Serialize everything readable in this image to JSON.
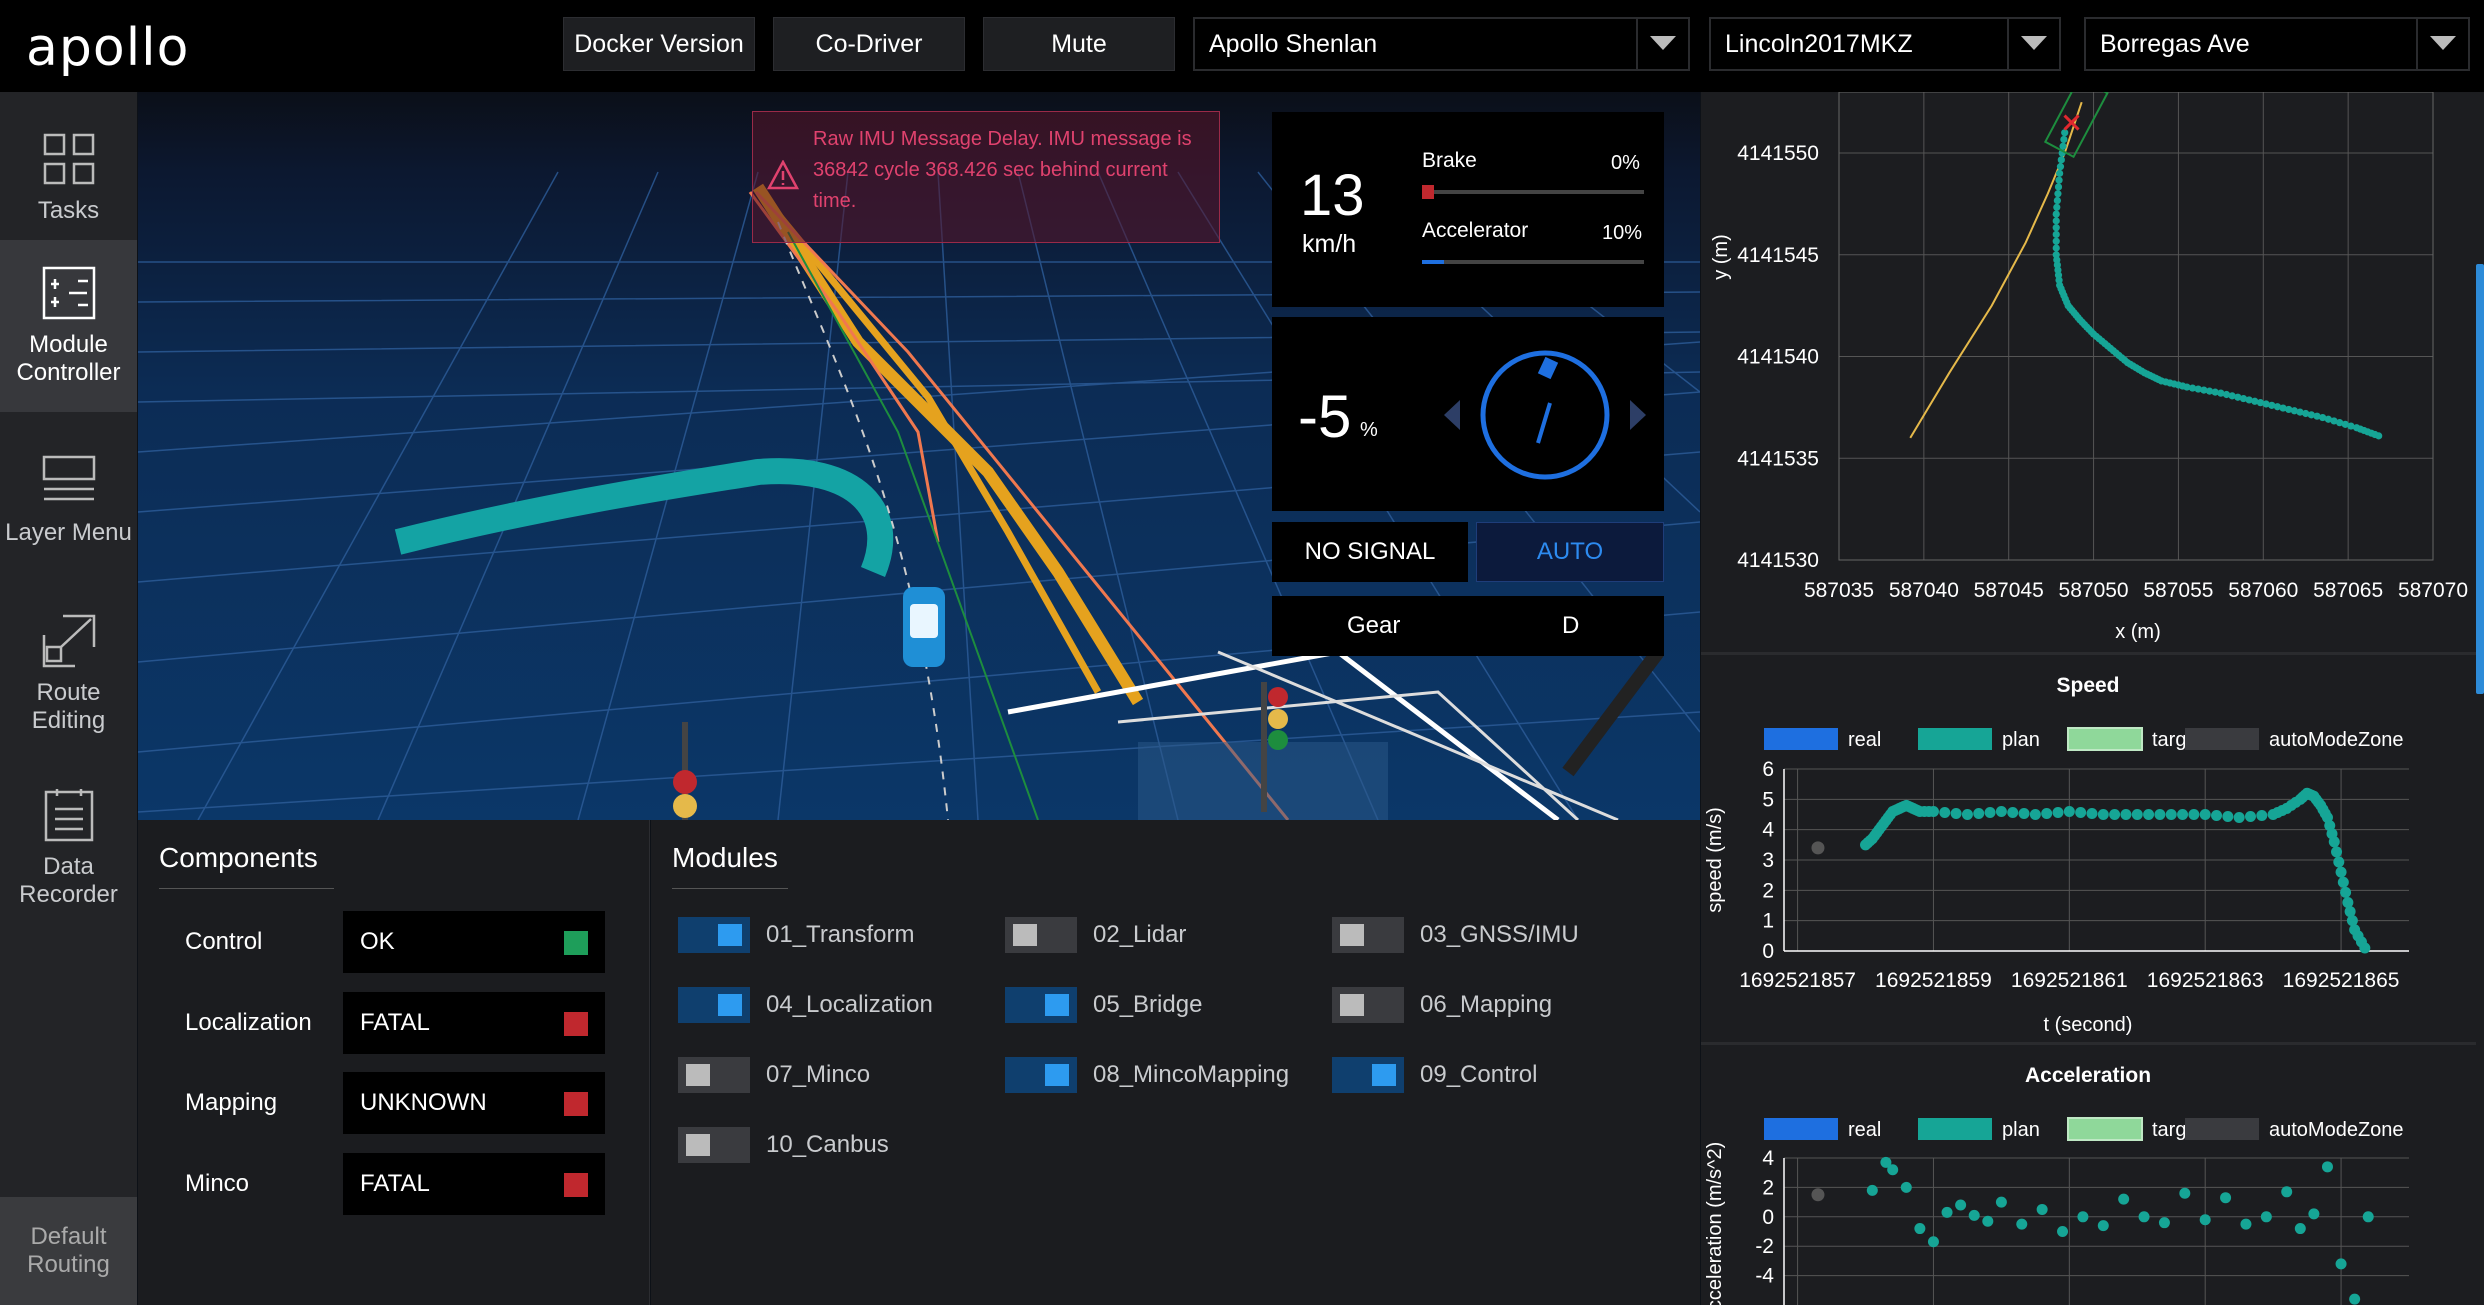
{
  "header": {
    "logo": "apollo",
    "buttons": [
      "Docker Version",
      "Co-Driver",
      "Mute"
    ],
    "mode_select": "Apollo Shenlan",
    "vehicle_select": "Lincoln2017MKZ",
    "map_select": "Borregas Ave"
  },
  "sidebar": {
    "items": [
      {
        "label": "Tasks",
        "icon": "grid-icon",
        "active": false
      },
      {
        "label": "Module Controller",
        "icon": "sliders-icon",
        "active": true
      },
      {
        "label": "Layer Menu",
        "icon": "layers-icon",
        "active": false
      },
      {
        "label": "Route Editing",
        "icon": "route-icon",
        "active": false
      },
      {
        "label": "Data Recorder",
        "icon": "document-icon",
        "active": false
      }
    ],
    "bottom": "Default Routing"
  },
  "alert": {
    "message": "Raw IMU Message Delay. IMU message is 36842 cycle 368.426 sec behind current time.",
    "line1": "Raw IMU Message Delay. IMU message is",
    "line2": "36842 cycle 368.426 sec behind current",
    "line3": "time."
  },
  "dashboard": {
    "speed": "13",
    "speed_unit": "km/h",
    "brake_label": "Brake",
    "brake_value": "0%",
    "brake_fraction": 0.0,
    "accel_label": "Accelerator",
    "accel_value": "10%",
    "accel_fraction": 0.1,
    "steering": "-5",
    "steering_unit": "%",
    "signal": "NO SIGNAL",
    "mode": "AUTO",
    "gear_label": "Gear",
    "gear_value": "D"
  },
  "components": {
    "title": "Components",
    "items": [
      {
        "label": "Control",
        "status": "OK",
        "color": "#1e9e5a"
      },
      {
        "label": "Localization",
        "status": "FATAL",
        "color": "#c0282e"
      },
      {
        "label": "Mapping",
        "status": "UNKNOWN",
        "color": "#c0282e"
      },
      {
        "label": "Minco",
        "status": "FATAL",
        "color": "#c0282e"
      }
    ]
  },
  "modules": {
    "title": "Modules",
    "items": [
      {
        "label": "01_Transform",
        "on": true
      },
      {
        "label": "02_Lidar",
        "on": false
      },
      {
        "label": "03_GNSS/IMU",
        "on": false
      },
      {
        "label": "04_Localization",
        "on": true
      },
      {
        "label": "05_Bridge",
        "on": true
      },
      {
        "label": "06_Mapping",
        "on": false
      },
      {
        "label": "07_Minco",
        "on": false
      },
      {
        "label": "08_MincoMapping",
        "on": true
      },
      {
        "label": "09_Control",
        "on": true
      },
      {
        "label": "10_Canbus",
        "on": false
      }
    ]
  },
  "colors": {
    "accent": "#1e6fe0",
    "plan": "#16a596",
    "ok": "#1e9e5a",
    "fatal": "#c0282e",
    "alert": "#e0426e"
  },
  "chart_data": [
    {
      "type": "scatter",
      "xlabel": "x (m)",
      "ylabel": "y (m)",
      "xlim": [
        587035,
        587070
      ],
      "ylim": [
        4141530,
        4141553
      ],
      "x_ticks": [
        "587035",
        "587040",
        "587045",
        "587050",
        "587055",
        "587060",
        "587065",
        "587070"
      ],
      "y_ticks": [
        "4141530",
        "4141535",
        "4141540",
        "4141545",
        "4141550"
      ],
      "series": [
        {
          "kind": "line",
          "color": "#e5b94a",
          "x": [
            587039.2,
            587041.5,
            587044.0,
            587046.0,
            587047.3,
            587048.3,
            587049.3
          ],
          "y": [
            4141536.0,
            4141539.2,
            4141542.5,
            4141545.6,
            4141548.0,
            4141550.0,
            4141552.5
          ]
        },
        {
          "kind": "points",
          "color": "#16a596",
          "x": [
            587048.3,
            587048.0,
            587047.8,
            587047.8,
            587048.0,
            587048.5,
            587049.2,
            587050.0,
            587051.0,
            587052.0,
            587053.0,
            587054.0,
            587055.5,
            587057.5,
            587059.5,
            587061.5,
            587063.5,
            587065.5,
            587066.8
          ],
          "y": [
            4141551.0,
            4141549.0,
            4141547.0,
            4141545.0,
            4141543.5,
            4141542.5,
            4141541.8,
            4141541.1,
            4141540.4,
            4141539.7,
            4141539.2,
            4141538.8,
            4141538.5,
            4141538.2,
            4141537.8,
            4141537.4,
            4141537.0,
            4141536.5,
            4141536.1
          ]
        }
      ]
    },
    {
      "type": "scatter",
      "title": "Speed",
      "xlabel": "t (second)",
      "ylabel": "speed (m/s)",
      "xlim": [
        1692521856.8,
        1692521866.0
      ],
      "ylim": [
        0,
        6
      ],
      "x_ticks": [
        "1692521857",
        "1692521859",
        "1692521861",
        "1692521863",
        "1692521865"
      ],
      "y_ticks": [
        "0",
        "1",
        "2",
        "3",
        "4",
        "5",
        "6"
      ],
      "legend": [
        "real",
        "plan",
        "target",
        "autoModeZone"
      ],
      "legend_colors": [
        "#1e6fe0",
        "#16a596",
        "#8fd89a",
        "#3a3b3f"
      ],
      "series": [
        {
          "name": "plan",
          "color": "#16a596",
          "x": [
            1692521858.0,
            1692521858.1,
            1692521858.2,
            1692521858.3,
            1692521858.4,
            1692521858.5,
            1692521858.6,
            1692521858.7,
            1692521858.8,
            1692521859.0,
            1692521859.5,
            1692521860.0,
            1692521860.5,
            1692521861.0,
            1692521861.5,
            1692521862.0,
            1692521862.5,
            1692521863.0,
            1692521863.5,
            1692521864.0,
            1692521864.2,
            1692521864.4,
            1692521864.5,
            1692521864.6,
            1692521864.7,
            1692521864.8,
            1692521864.9,
            1692521865.0,
            1692521865.1,
            1692521865.2,
            1692521865.35
          ],
          "y": [
            3.5,
            3.7,
            4.0,
            4.3,
            4.6,
            4.7,
            4.8,
            4.7,
            4.6,
            4.6,
            4.5,
            4.6,
            4.5,
            4.6,
            4.5,
            4.5,
            4.5,
            4.5,
            4.4,
            4.5,
            4.7,
            5.0,
            5.2,
            5.1,
            4.8,
            4.4,
            3.6,
            2.6,
            1.6,
            0.7,
            0.1
          ]
        },
        {
          "name": "real",
          "color": "#555555",
          "x": [
            1692521857.3
          ],
          "y": [
            3.4
          ]
        }
      ]
    },
    {
      "type": "scatter",
      "title": "Acceleration",
      "xlabel": "t (second)",
      "ylabel": "acceleration (m/s^2)",
      "xlim": [
        1692521856.8,
        1692521866.0
      ],
      "ylim": [
        -6,
        4
      ],
      "y_ticks": [
        "-4",
        "-2",
        "0",
        "2",
        "4"
      ],
      "legend": [
        "real",
        "plan",
        "target",
        "autoModeZone"
      ],
      "legend_colors": [
        "#1e6fe0",
        "#16a596",
        "#8fd89a",
        "#3a3b3f"
      ],
      "series": [
        {
          "name": "plan",
          "color": "#16a596",
          "x": [
            1692521858.1,
            1692521858.3,
            1692521858.4,
            1692521858.6,
            1692521858.8,
            1692521859.0,
            1692521859.2,
            1692521859.4,
            1692521859.6,
            1692521859.8,
            1692521860.0,
            1692521860.3,
            1692521860.6,
            1692521860.9,
            1692521861.2,
            1692521861.5,
            1692521861.8,
            1692521862.1,
            1692521862.4,
            1692521862.7,
            1692521863.0,
            1692521863.3,
            1692521863.6,
            1692521863.9,
            1692521864.2,
            1692521864.4,
            1692521864.6,
            1692521864.8,
            1692521865.0,
            1692521865.2,
            1692521865.4
          ],
          "y": [
            1.8,
            3.7,
            3.2,
            2.0,
            -0.8,
            -1.7,
            0.3,
            0.8,
            0.1,
            -0.3,
            1.0,
            -0.5,
            0.5,
            -1.0,
            0.0,
            -0.6,
            1.2,
            0.0,
            -0.4,
            1.6,
            -0.2,
            1.3,
            -0.5,
            0.0,
            1.7,
            -0.8,
            0.2,
            3.4,
            -3.2,
            -5.6,
            0.0
          ]
        },
        {
          "name": "real",
          "color": "#555555",
          "x": [
            1692521857.3
          ],
          "y": [
            1.5
          ]
        }
      ]
    }
  ]
}
